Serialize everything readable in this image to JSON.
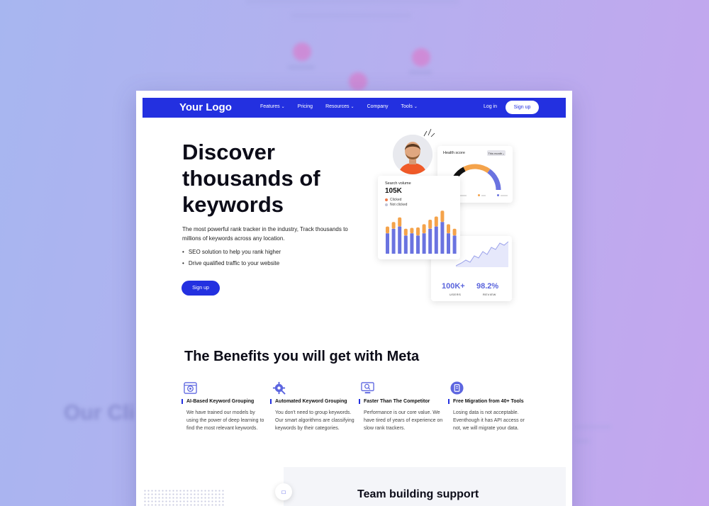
{
  "header": {
    "logo": "Your Logo",
    "nav": [
      {
        "label": "Features",
        "dropdown": true
      },
      {
        "label": "Pricing",
        "dropdown": false
      },
      {
        "label": "Resources",
        "dropdown": true
      },
      {
        "label": "Company",
        "dropdown": false
      },
      {
        "label": "Tools",
        "dropdown": true
      }
    ],
    "login_label": "Log in",
    "signup_label": "Sign up"
  },
  "hero": {
    "title": "Discover thousands of keywords",
    "description": "The most powerful rank tracker in the industry, Track thousands to millions of keywords across any location.",
    "bullets": [
      "SEO solution to help you rank higher",
      "Drive qualified traffic to your website"
    ],
    "cta_label": "Sign up"
  },
  "dashboard": {
    "health_score": {
      "title": "Health score",
      "dropdown": "This month",
      "segments": [
        {
          "color": "#111111",
          "value": 35
        },
        {
          "color": "#f4a34b",
          "value": 35
        },
        {
          "color": "#6a73e0",
          "value": 30
        }
      ]
    },
    "search_volume": {
      "title": "Search volume",
      "value": "105K",
      "legend": [
        {
          "label": "Clicked",
          "color": "#f07a4a"
        },
        {
          "label": "Not clicked",
          "color": "#bfc2d6"
        }
      ],
      "bars": [
        {
          "blue": 0.45,
          "orange": 0.15
        },
        {
          "blue": 0.55,
          "orange": 0.15
        },
        {
          "blue": 0.6,
          "orange": 0.2
        },
        {
          "blue": 0.4,
          "orange": 0.15
        },
        {
          "blue": 0.45,
          "orange": 0.12
        },
        {
          "blue": 0.4,
          "orange": 0.18
        },
        {
          "blue": 0.45,
          "orange": 0.2
        },
        {
          "blue": 0.55,
          "orange": 0.2
        },
        {
          "blue": 0.6,
          "orange": 0.22
        },
        {
          "blue": 0.7,
          "orange": 0.25
        },
        {
          "blue": 0.45,
          "orange": 0.2
        },
        {
          "blue": 0.4,
          "orange": 0.15
        }
      ]
    },
    "stats": {
      "users_value": "100K+",
      "users_label": "USERS",
      "review_value": "98.2%",
      "review_label": "REVIEW"
    }
  },
  "benefits": {
    "title": "The Benefits you will get with Meta",
    "items": [
      {
        "title": "AI-Based Keyword Grouping",
        "desc": "We have trained our models by using the power of deep learning to find the most relevant keywords."
      },
      {
        "title": "Automated Keyword Grouping",
        "desc": "You don't need to group keywords. Our smart algorithms are classifying keywords by their categories."
      },
      {
        "title": "Faster Than The Competitor",
        "desc": "Performance is our core value. We have tired of years of experience on slow rank trackers."
      },
      {
        "title": "Free Migration from 40+ Tools",
        "desc": "Losing data is not acceptable. Eventhough it has API access or not, we will migrate your data."
      }
    ]
  },
  "team": {
    "title": "Team building support"
  },
  "background": {
    "heading": "Our Cli"
  },
  "colors": {
    "primary": "#2330e0",
    "accent_orange": "#f4a34b",
    "accent_blue": "#6a73e0"
  }
}
